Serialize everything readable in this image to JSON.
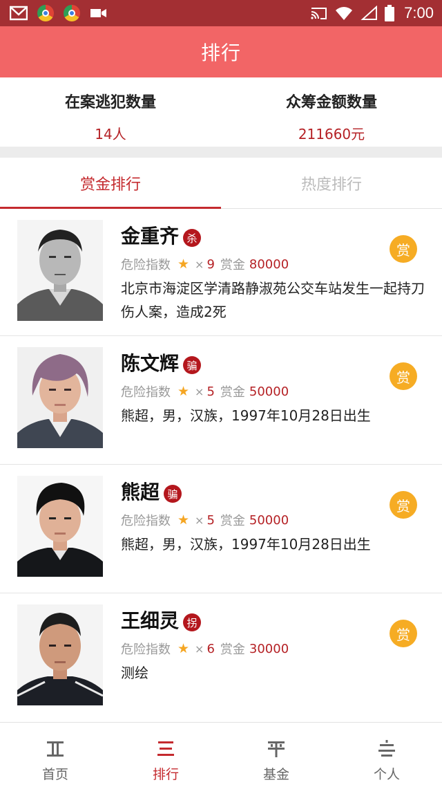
{
  "status_bar": {
    "time": "7:00",
    "left_icons": [
      "gmail-icon",
      "chrome-icon",
      "chrome-icon",
      "video-icon"
    ],
    "right_icons": [
      "cast-icon",
      "wifi-icon",
      "signal-icon",
      "battery-icon"
    ]
  },
  "header": {
    "title": "排行"
  },
  "stats": {
    "fugitives_label": "在案逃犯数量",
    "fugitives_value": "14人",
    "funding_label": "众筹金额数量",
    "funding_value": "211660元"
  },
  "tabs": [
    {
      "label": "赏金排行",
      "active": true
    },
    {
      "label": "热度排行",
      "active": false
    }
  ],
  "list": [
    {
      "name": "金重齐",
      "crime": "杀",
      "danger_label": "危险指数",
      "times": "×",
      "danger": "9",
      "bounty_label": "赏金",
      "bounty": "80000",
      "desc": "北京市海淀区学清路静淑苑公交车站发生一起持刀伤人案，造成2死",
      "reward": "赏"
    },
    {
      "name": "陈文辉",
      "crime": "骗",
      "danger_label": "危险指数",
      "times": "×",
      "danger": "5",
      "bounty_label": "赏金",
      "bounty": "50000",
      "desc": "熊超，男，汉族，1997年10月28日出生",
      "reward": "赏"
    },
    {
      "name": "熊超",
      "crime": "骗",
      "danger_label": "危险指数",
      "times": "×",
      "danger": "5",
      "bounty_label": "赏金",
      "bounty": "50000",
      "desc": "熊超，男，汉族，1997年10月28日出生",
      "reward": "赏"
    },
    {
      "name": "王细灵",
      "crime": "拐",
      "danger_label": "危险指数",
      "times": "×",
      "danger": "6",
      "bounty_label": "赏金",
      "bounty": "30000",
      "desc": "测绘",
      "reward": "赏"
    }
  ],
  "bottom_nav": [
    {
      "label": "首页",
      "icon": "home-icon",
      "active": false
    },
    {
      "label": "排行",
      "icon": "ranking-icon",
      "active": true
    },
    {
      "label": "基金",
      "icon": "fund-icon",
      "active": false
    },
    {
      "label": "个人",
      "icon": "profile-icon",
      "active": false
    }
  ],
  "colors": {
    "status_bar": "#a32f33",
    "title_bar": "#f26566",
    "accent": "#c42a2e",
    "reward_badge": "#f6ac24",
    "star": "#f5a623"
  }
}
